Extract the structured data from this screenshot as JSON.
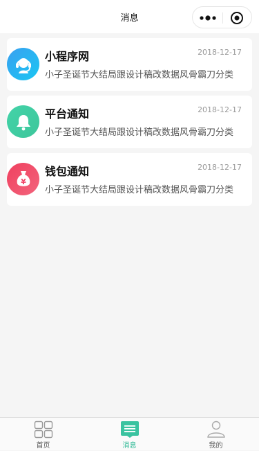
{
  "nav": {
    "title": "消息"
  },
  "messages": [
    {
      "title": "小程序网",
      "date": "2018-12-17",
      "desc": "小子圣诞节大结局跟设计稿改数据风骨霸刀分类",
      "icon": "headset-icon",
      "color": "#2fa7ec"
    },
    {
      "title": "平台通知",
      "date": "2018-12-17",
      "desc": "小子圣诞节大结局跟设计稿改数据风骨霸刀分类",
      "icon": "bell-icon",
      "color": "#3ecfa3"
    },
    {
      "title": "钱包通知",
      "date": "2018-12-17",
      "desc": "小子圣诞节大结局跟设计稿改数据风骨霸刀分类",
      "icon": "money-bag-icon",
      "color": "#f2476a"
    }
  ],
  "tabs": [
    {
      "label": "首页",
      "icon": "home-grid-icon",
      "active": false
    },
    {
      "label": "消息",
      "icon": "message-icon",
      "active": true
    },
    {
      "label": "我的",
      "icon": "user-icon",
      "active": false
    }
  ],
  "colors": {
    "accent": "#2bb894",
    "background": "#f5f5f5"
  }
}
